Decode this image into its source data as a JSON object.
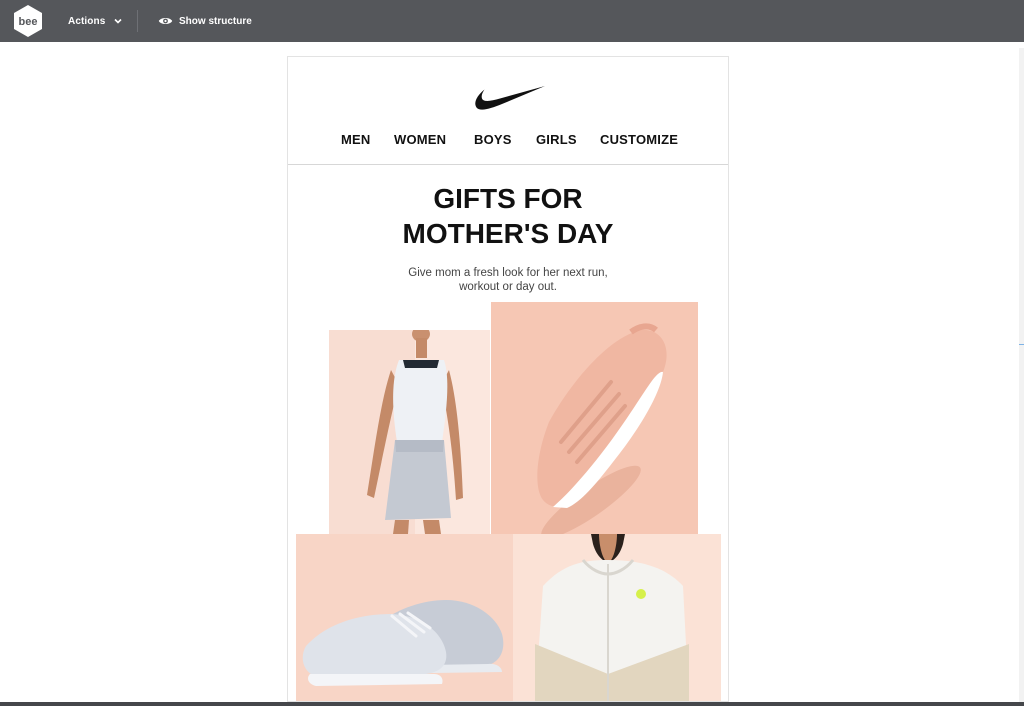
{
  "toolbar": {
    "logo_text": "bee",
    "actions_label": "Actions",
    "show_structure_label": "Show structure"
  },
  "email": {
    "brand": "Nike",
    "nav": [
      "MEN",
      "WOMEN",
      "BOYS",
      "GIRLS",
      "CUSTOMIZE"
    ],
    "title_line1": "GIFTS FOR",
    "title_line2": "MOTHER'S DAY",
    "subtitle_line1": "Give mom a fresh look for her next run,",
    "subtitle_line2": "workout or day out."
  },
  "colors": {
    "toolbar_bg": "#55575b",
    "tile_peach_light": "#f8ddd2",
    "tile_peach": "#f6c7b4",
    "text_dark": "#111111"
  }
}
